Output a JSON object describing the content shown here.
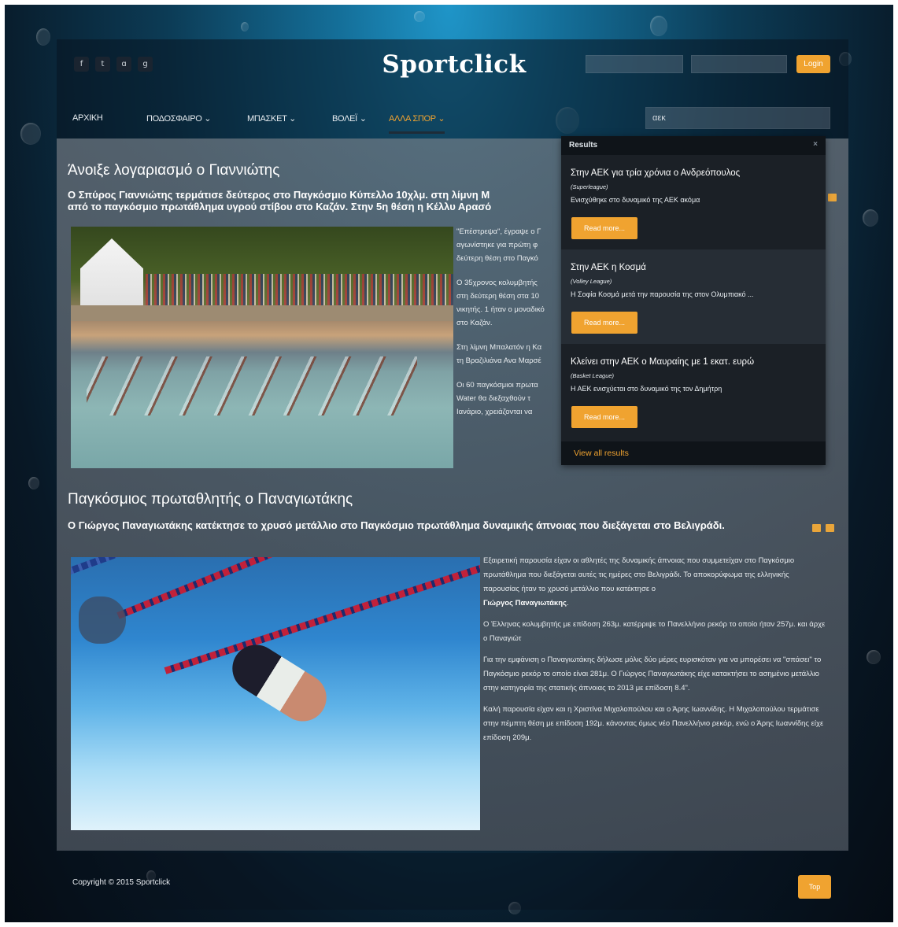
{
  "site": {
    "logo": "Sportclick"
  },
  "social": {
    "icons": [
      "facebook-icon",
      "twitter-icon",
      "rss-icon",
      "google-plus-icon"
    ],
    "glyphs": [
      "f",
      "t",
      "ɑ",
      "g"
    ]
  },
  "login": {
    "button_label": "Login"
  },
  "nav": {
    "items": [
      "ΑΡΧΙΚΗ",
      "ΠΟΔΟΣΦΑΙΡΟ ⌄",
      "ΜΠΑΣΚΕΤ ⌄",
      "ΒΟΛΕΪ ⌄",
      "ΑΛΛΑ ΣΠΟΡ ⌄"
    ],
    "active_index": 4,
    "search_value": "αεκ"
  },
  "articles": [
    {
      "title": "Άνοιξε λογαριασμό ο Γιαννιώτης",
      "lead": "Ο Σπύρος Γιαννιώτης τερμάτισε δεύτερος στο Παγκόσμιο Κύπελλο 10χλμ. στη λίμνη Μ",
      "lead_2": "από το παγκόσμιο πρωτάθλημα υγρού στίβου στο Καζάν. Στην 5η θέση η Κέλλυ Αρασό",
      "paragraphs": [
        "\"Επέστρεψα\", έγραψε ο Γ",
        "αγωνίστηκε για πρώτη φ",
        "δεύτερη θέση στο Παγκό",
        "Ο 35χρονος κολυμβητής",
        "στη δεύτερη θέση στα 10",
        "νικητής. 1 ήταν ο μοναδικό",
        "στο Καζάν.",
        "Στη λίμνη Μπαλατόν η Κα",
        "τη Βραζιλιάνα Ανα Μαρσέ",
        "Οι 60 παγκόσμιοι πρωτα",
        "Water θα διεξαχθούν τ",
        "Ιανάριο, χρειάζονται να"
      ]
    },
    {
      "title": "Παγκόσμιος πρωταθλητής ο Παναγιωτάκης",
      "lead": "Ο Γιώργος Παναγιωτάκης κατέκτησε το χρυσό μετάλλιο στο Παγκόσμιο πρωτάθλημα δυναμικής άπνοιας που διεξάγεται στο Βελιγράδι.",
      "paragraphs": [
        "Εξαιρετική παρουσία είχαν οι αθλητές της δυναμικής άπνοιας που συμμετείχαν στο Παγκόσμιο πρωτάθλημα που διεξάγεται αυτές τις ημέρες στο Βελιγράδι. Το αποκορύφωμα της ελληνικής παρουσίας ήταν το χρυσό μετάλλιο που κατέκτησε ο",
        "Ο Έλληνας κολυμβητής με επίδοση 263μ. κατέρριψε το Πανελλήνιο ρεκόρ το οποίο ήταν 257μ. και άρχε ο Παναγιώτ",
        "Για την εμφάνιση ο Παναγιωτάκης δήλωσε μόλις δύο μέρες ευρισκόταν για να μπορέσει να \"σπάσει\" το Παγκόσμιο ρεκόρ το οποίο είναι 281μ. Ο Γιώργος Παναγιωτάκης είχε κατακτήσει το ασημένιο μετάλλιο στην κατηγορία της στατικής άπνοιας το 2013 με επίδοση 8.4\".",
        "Καλή παρουσία είχαν και η Χριστίνα Μιχαλοπούλου και ο Άρης Ιωαννίδης. Η Μιχαλοπούλου τερμάτισε στην πέμπτη θέση με επίδοση 192μ. κάνοντας όμως νέο Πανελλήνιο ρεκόρ, ενώ ο Άρης Ιωαννίδης είχε επίδοση 209μ."
      ],
      "bold_name": "Γιώργος Παναγιωτάκης"
    }
  ],
  "search_results": {
    "header": "Results",
    "close": "×",
    "items": [
      {
        "title": "Στην ΑΕΚ για τρία χρόνια ο Ανδρεόπουλος",
        "category": "(Superleague)",
        "text": "Ενισχύθηκε στο δυναμικό της ΑΕΚ ακόμα",
        "button": "Read more..."
      },
      {
        "title": "Στην ΑΕΚ η Κοσμά",
        "category": "(Volley League)",
        "text": "Η Σοφία Κοσμά μετά την παρουσία της στον Ολυμπιακό ...",
        "button": "Read more..."
      },
      {
        "title": "Κλείνει στην ΑΕΚ ο Μαυραίης με 1 εκατ. ευρώ",
        "category": "(Basket League)",
        "text": "Η ΑΕΚ ενισχύεται στο δυναμικό της τον Δημήτρη",
        "button": "Read more..."
      }
    ],
    "footer": "View all results"
  },
  "footer": {
    "copyright": "Copyright © 2015 Sportclick",
    "top_button": "Top"
  },
  "colors": {
    "accent": "#f0a330",
    "panel": "#1b2026",
    "content": "#5f6973"
  }
}
